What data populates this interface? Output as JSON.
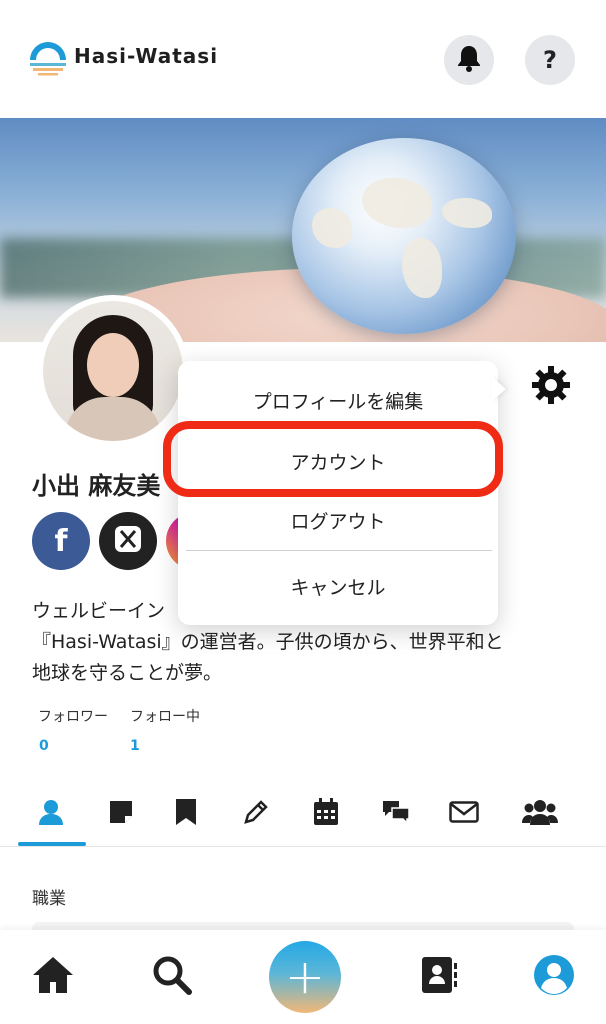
{
  "app": {
    "title": "Hasi-Watasi"
  },
  "header": {
    "icons": [
      "bell-icon",
      "help-icon"
    ],
    "help_glyph": "?"
  },
  "profile": {
    "name": "小出 麻友美",
    "social": [
      {
        "name": "facebook",
        "glyph": "f"
      },
      {
        "name": "x"
      },
      {
        "name": "instagram"
      }
    ],
    "bio_lines": [
      "ウェルビーイン　　　　　　　　　　　　　　ォーム",
      "『Hasi-Watasi』の運営者。子供の頃から、世界平和と",
      "地球を守ることが夢。"
    ],
    "followers_label": "フォロワー",
    "followers_count": "0",
    "following_label": "フォロー中",
    "following_count": "1"
  },
  "tabs": [
    {
      "name": "profile",
      "icon": "person-icon",
      "active": true
    },
    {
      "name": "notes",
      "icon": "sticky-note-icon"
    },
    {
      "name": "bookmarks",
      "icon": "bookmark-icon"
    },
    {
      "name": "edit",
      "icon": "pencil-icon"
    },
    {
      "name": "calendar",
      "icon": "calendar-icon"
    },
    {
      "name": "chat",
      "icon": "chat-icon"
    },
    {
      "name": "mail",
      "icon": "envelope-icon"
    },
    {
      "name": "groups",
      "icon": "group-icon"
    }
  ],
  "section": {
    "occupation_title": "職業"
  },
  "menu": {
    "edit_profile": "プロフィールを編集",
    "account": "アカウント",
    "logout": "ログアウト",
    "cancel": "キャンセル"
  },
  "bottom_nav": {
    "items": [
      "home-icon",
      "search-icon",
      "add-icon",
      "contacts-icon",
      "profile-icon"
    ],
    "add_glyph": "+"
  },
  "colors": {
    "accent": "#1d9bd8",
    "highlight": "#ef2b16",
    "facebook": "#3b5a96"
  }
}
